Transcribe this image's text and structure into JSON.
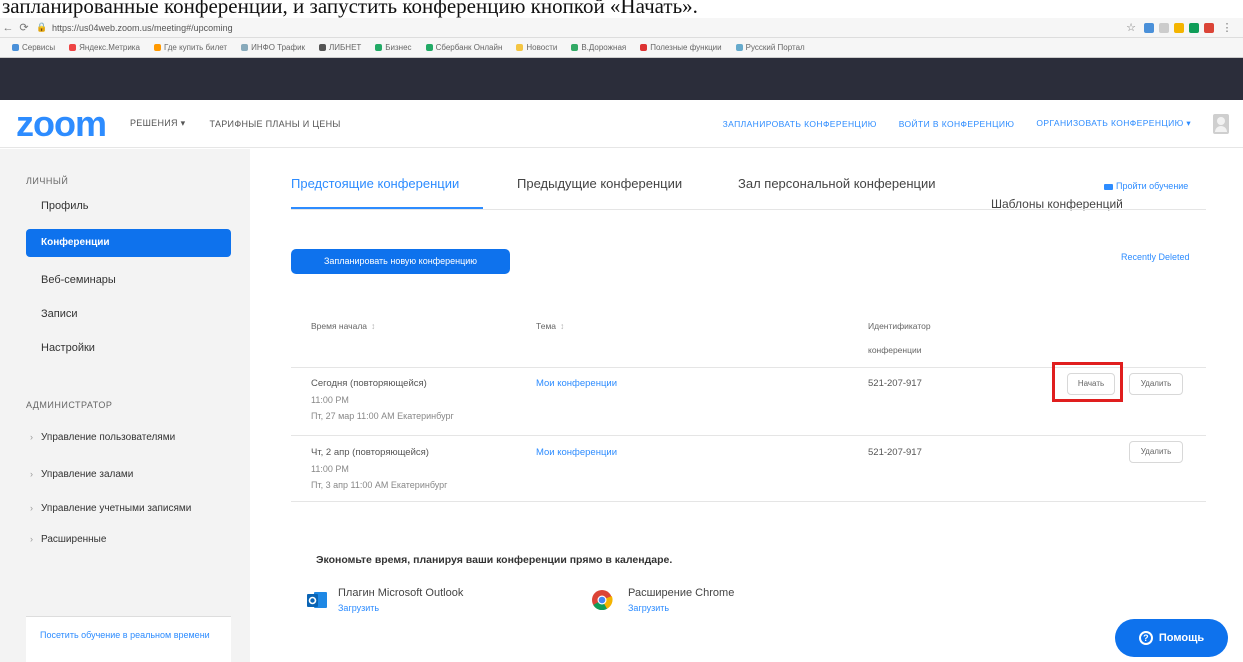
{
  "caption": "запланированные конференции, и запустить конференцию кнопкой «Начать».",
  "browser": {
    "url": "https://us04web.zoom.us/meeting#/upcoming",
    "bookmarks": [
      "Сервисы",
      "Яндекс.Метрика",
      "Где купить билет",
      "ИНФО Трафик",
      "ЛИБНЕТ",
      "Бизнес",
      "Сбербанк Онлайн",
      "Новости",
      "В.Дорожная",
      "Полезные функции",
      "Русский Портал"
    ],
    "ext_colors": [
      "#4a90d9",
      "#cccccc",
      "#f4b400",
      "#0f9d58",
      "#db4437"
    ]
  },
  "header": {
    "logo": "zoom",
    "nav_solutions": "РЕШЕНИЯ ▾",
    "nav_plans": "ТАРИФНЫЕ ПЛАНЫ И ЦЕНЫ",
    "schedule": "ЗАПЛАНИРОВАТЬ КОНФЕРЕНЦИЮ",
    "join": "ВОЙТИ В КОНФЕРЕНЦИЮ",
    "host": "ОРГАНИЗОВАТЬ КОНФЕРЕНЦИЮ ▾"
  },
  "sidebar": {
    "personal": "ЛИЧНЫЙ",
    "items": [
      "Профиль",
      "Конференции",
      "Веб-семинары",
      "Записи",
      "Настройки"
    ],
    "admin": "АДМИНИСТРАТОР",
    "admin_items": [
      "Управление пользователями",
      "Управление залами",
      "Управление учетными записями",
      "Расширенные"
    ],
    "bottom": "Посетить обучение в реальном времени"
  },
  "main": {
    "tabs": [
      "Предстоящие конференции",
      "Предыдущие конференции",
      "Зал персональной конференции"
    ],
    "templates": "Шаблоны конференций",
    "training": "Пройти обучение",
    "schedule_new": "Запланировать новую конференцию",
    "recently_deleted": "Recently Deleted",
    "columns": {
      "start": "Время начала",
      "topic": "Тема",
      "id_line1": "Идентификатор",
      "id_line2": "конференции"
    },
    "rows": [
      {
        "date": "Сегодня (повторяющейся)",
        "time": "11:00 PM",
        "next": "Пт, 27 мар 11:00 AM Екатеринбург",
        "topic": "Мои конференции",
        "id": "521-207-917",
        "start_btn": "Начать",
        "delete_btn": "Удалить"
      },
      {
        "date": "Чт, 2 апр (повторяющейся)",
        "time": "11:00 PM",
        "next": "Пт, 3 апр 11:00 AM Екатеринбург",
        "topic": "Мои конференции",
        "id": "521-207-917",
        "delete_btn": "Удалить"
      }
    ],
    "calendar_title": "Экономьте время, планируя ваши конференции прямо в календаре.",
    "plugins": [
      {
        "name": "Плагин Microsoft Outlook",
        "link": "Загрузить"
      },
      {
        "name": "Расширение Chrome",
        "link": "Загрузить"
      }
    ],
    "help": "Помощь"
  }
}
